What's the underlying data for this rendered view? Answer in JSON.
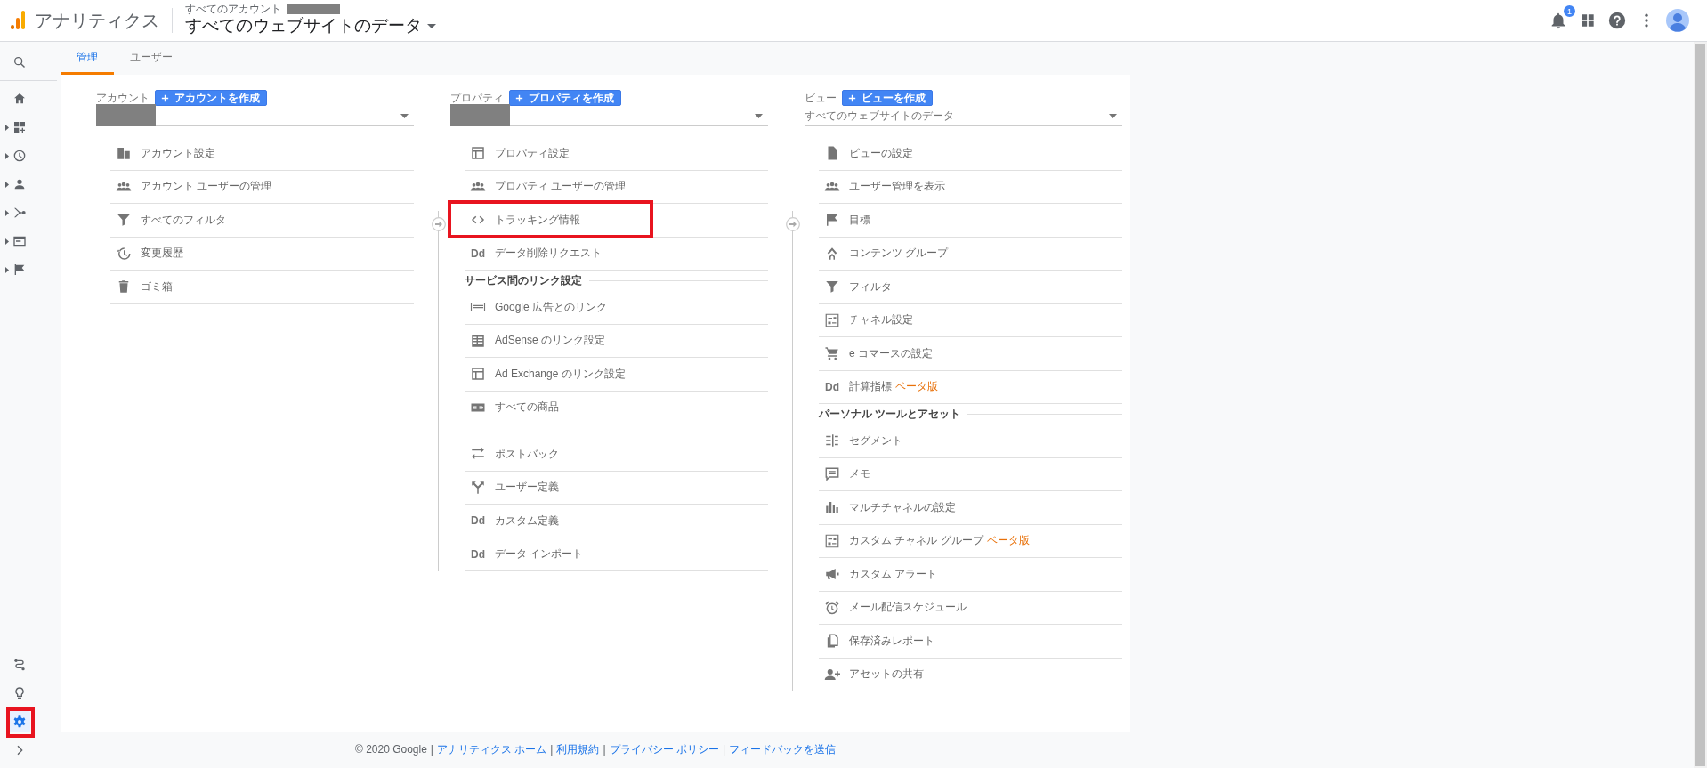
{
  "header": {
    "app_name": "アナリティクス",
    "account_label": "すべてのアカウント",
    "account_redacted": true,
    "view_title": "すべてのウェブサイトのデータ",
    "notification_count": "1"
  },
  "sidebar": {
    "top_items": [
      {
        "expandable": false,
        "selected": false
      },
      {
        "expandable": false,
        "selected": false
      },
      {
        "expandable": true,
        "selected": false
      },
      {
        "expandable": true,
        "selected": false
      },
      {
        "expandable": true,
        "selected": false
      },
      {
        "expandable": true,
        "selected": false
      },
      {
        "expandable": true,
        "selected": false
      },
      {
        "expandable": true,
        "selected": false
      }
    ],
    "bottom_items": [
      {
        "selected": false,
        "highlighted": false
      },
      {
        "selected": false,
        "highlighted": false
      },
      {
        "selected": true,
        "highlighted": true
      },
      {
        "selected": false,
        "highlighted": false
      }
    ]
  },
  "tabs": [
    {
      "label": "管理",
      "selected": true
    },
    {
      "label": "ユーザー",
      "selected": false
    }
  ],
  "columns": [
    {
      "label": "アカウント",
      "create_button": "アカウントを作成",
      "selector": {
        "redacted": true
      },
      "groups": [
        {
          "items": [
            {
              "label": "アカウント設定",
              "highlighted": false
            },
            {
              "label": "アカウント ユーザーの管理",
              "highlighted": false
            },
            {
              "label": "すべてのフィルタ",
              "highlighted": false
            },
            {
              "label": "変更履歴",
              "highlighted": false
            },
            {
              "label": "ゴミ箱",
              "highlighted": false
            }
          ]
        }
      ]
    },
    {
      "label": "プロパティ",
      "create_button": "プロパティを作成",
      "selector": {
        "redacted": true
      },
      "groups": [
        {
          "items": [
            {
              "label": "プロパティ設定",
              "highlighted": false
            },
            {
              "label": "プロパティ ユーザーの管理",
              "highlighted": false
            },
            {
              "label": "トラッキング情報",
              "highlighted": true
            },
            {
              "label": "データ削除リクエスト",
              "icon_text": "Dd",
              "highlighted": false
            }
          ]
        },
        {
          "heading": "サービス間のリンク設定",
          "items": [
            {
              "label": "Google 広告とのリンク",
              "highlighted": false
            },
            {
              "label": "AdSense のリンク設定",
              "highlighted": false
            },
            {
              "label": "Ad Exchange のリンク設定",
              "highlighted": false
            },
            {
              "label": "すべての商品",
              "highlighted": false
            }
          ]
        },
        {
          "items": [
            {
              "label": "ポストバック",
              "highlighted": false
            },
            {
              "label": "ユーザー定義",
              "highlighted": false
            },
            {
              "label": "カスタム定義",
              "icon_text": "Dd",
              "highlighted": false
            },
            {
              "label": "データ インポート",
              "icon_text": "Dd",
              "highlighted": false
            }
          ]
        }
      ]
    },
    {
      "label": "ビュー",
      "create_button": "ビューを作成",
      "selector": {
        "value": "すべてのウェブサイトのデータ"
      },
      "groups": [
        {
          "items": [
            {
              "label": "ビューの設定",
              "highlighted": false
            },
            {
              "label": "ユーザー管理を表示",
              "highlighted": false
            },
            {
              "label": "目標",
              "highlighted": false
            },
            {
              "label": "コンテンツ グループ",
              "highlighted": false
            },
            {
              "label": "フィルタ",
              "highlighted": false
            },
            {
              "label": "チャネル設定",
              "highlighted": false
            },
            {
              "label": "e コマースの設定",
              "highlighted": false
            },
            {
              "label": "計算指標",
              "badge": "ベータ版",
              "icon_text": "Dd",
              "highlighted": false
            }
          ]
        },
        {
          "heading": "パーソナル ツールとアセット",
          "items": [
            {
              "label": "セグメント",
              "highlighted": false
            },
            {
              "label": "メモ",
              "highlighted": false
            },
            {
              "label": "マルチチャネルの設定",
              "highlighted": false
            },
            {
              "label": "カスタム チャネル グループ",
              "badge": "ベータ版",
              "highlighted": false
            },
            {
              "label": "カスタム アラート",
              "highlighted": false
            },
            {
              "label": "メール配信スケジュール",
              "highlighted": false
            },
            {
              "label": "保存済みレポート",
              "highlighted": false
            },
            {
              "label": "アセットの共有",
              "highlighted": false
            }
          ]
        }
      ]
    }
  ],
  "footer": [
    {
      "kind": "text",
      "text": "© 2020 Google"
    },
    {
      "kind": "separator",
      "text": "|"
    },
    {
      "kind": "link",
      "text": "アナリティクス ホーム"
    },
    {
      "kind": "separator",
      "text": "|"
    },
    {
      "kind": "link",
      "text": "利用規約"
    },
    {
      "kind": "separator",
      "text": "|"
    },
    {
      "kind": "link",
      "text": "プライバシー ポリシー"
    },
    {
      "kind": "separator",
      "text": "|"
    },
    {
      "kind": "link",
      "text": "フィードバックを送信"
    }
  ]
}
